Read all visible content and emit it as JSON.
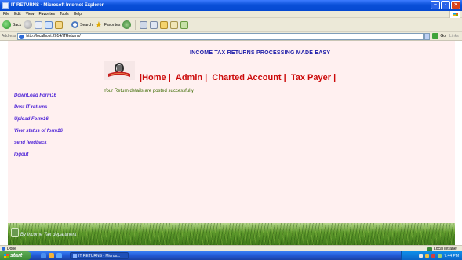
{
  "window": {
    "title": "IT RETURNS - Microsoft Internet Explorer"
  },
  "menu": [
    "File",
    "Edit",
    "View",
    "Favorites",
    "Tools",
    "Help"
  ],
  "toolbar": {
    "back": "Back",
    "search": "Search",
    "favorites": "Favorites"
  },
  "address": {
    "label": "Address",
    "url": "http://localhost:2014/ITReturns/",
    "go": "Go",
    "links": "Links"
  },
  "page": {
    "heading": "INCOME TAX RETURNS PROCESSING MADE EASY",
    "nav": [
      "Home",
      "Admin",
      "Charted Account",
      "Tax Payer"
    ],
    "status_message": "Your Return details are posted successfully",
    "sidebar": [
      "DownLoad Form16",
      "Post IT returns",
      "Upload Form16",
      "View status of form16",
      "send feedback",
      "logout"
    ],
    "footer_text": "By Income Tax department"
  },
  "statusbar": {
    "status": "Done",
    "zone": "Local intranet"
  },
  "taskbar": {
    "start": "start",
    "task": "IT RETURNS - Micros...",
    "clock": "7:44 PM"
  }
}
